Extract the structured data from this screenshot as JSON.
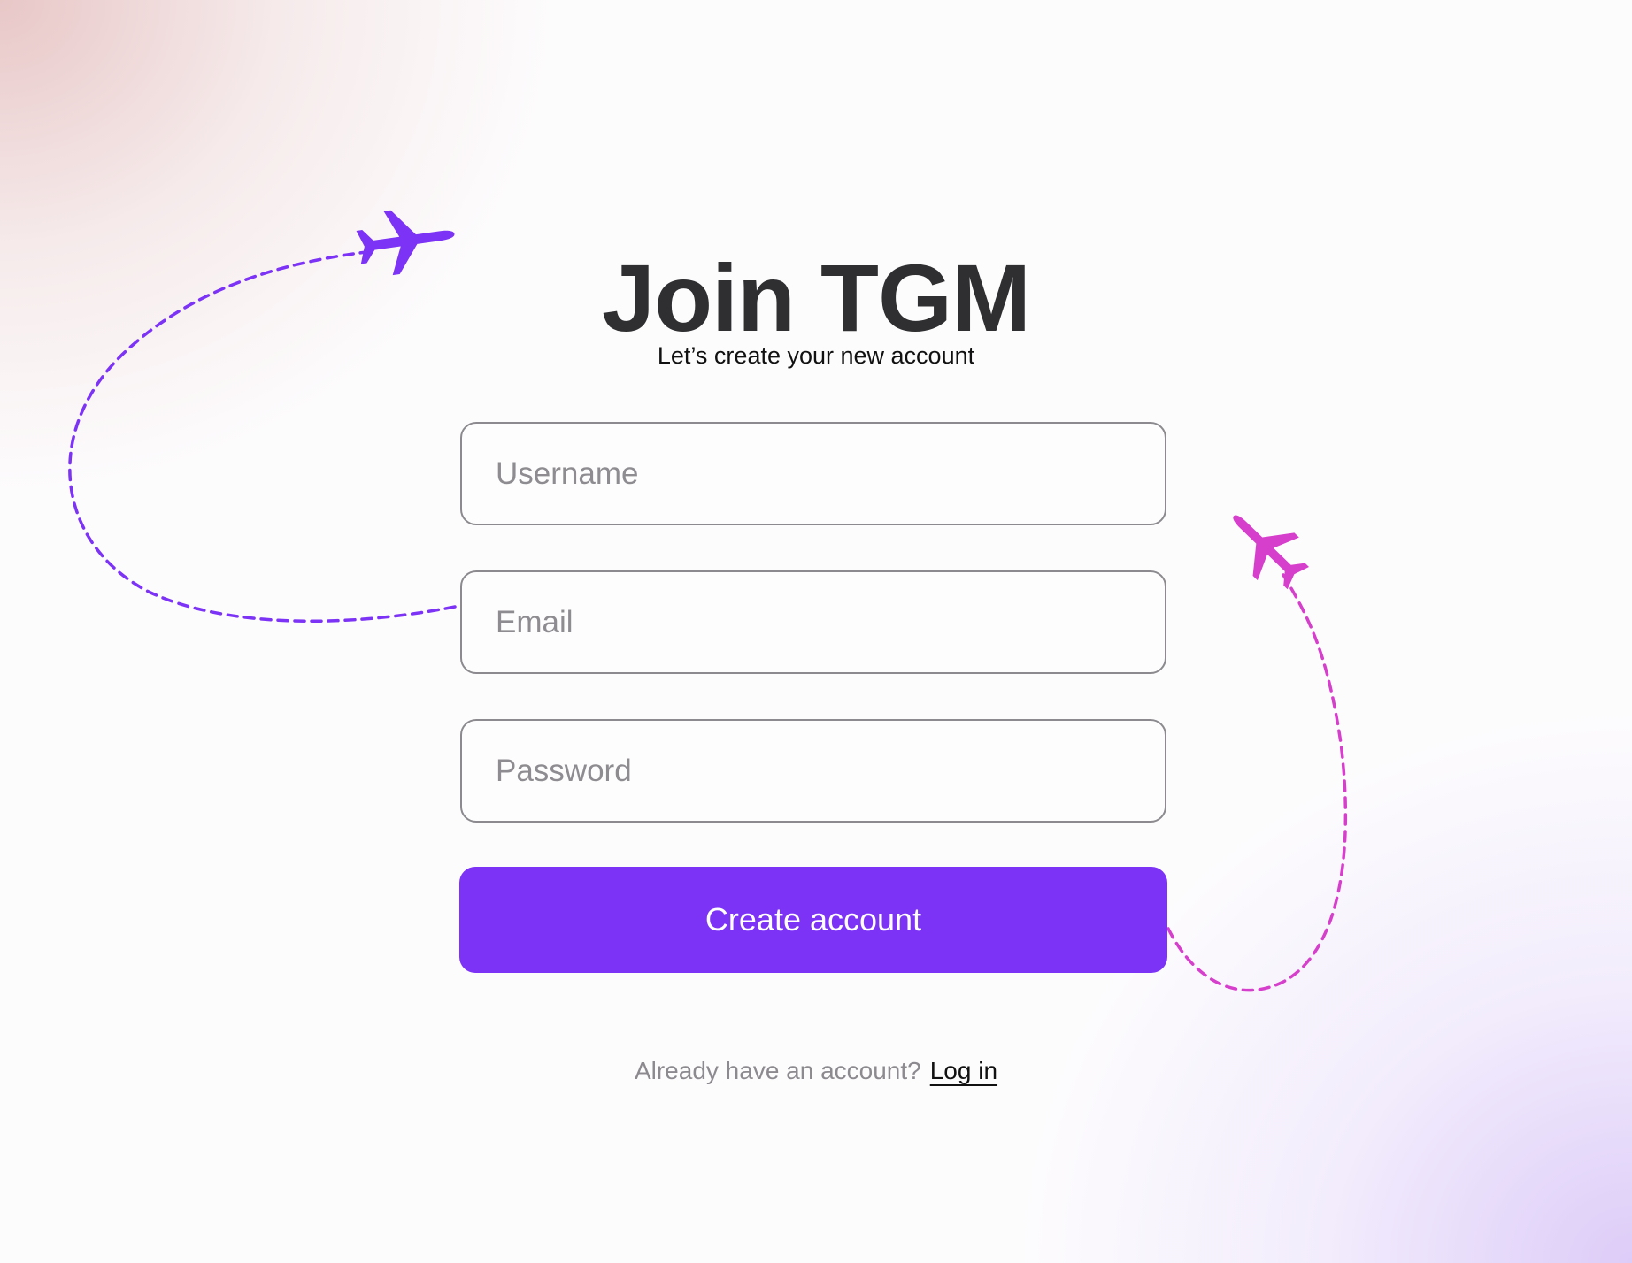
{
  "colors": {
    "accent": "#7c33f5",
    "title": "#2f2f31",
    "plane_left": "#7c33f5",
    "plane_right": "#d63fcb"
  },
  "header": {
    "title": "Join TGM",
    "subtitle": "Let’s create your new account"
  },
  "form": {
    "username_placeholder": "Username",
    "email_placeholder": "Email",
    "password_placeholder": "Password",
    "submit_label": "Create account"
  },
  "footer": {
    "prompt": "Already have an account?",
    "login_label": "Log in"
  },
  "decorations": {
    "left_icon": "airplane-icon",
    "right_icon": "airplane-icon"
  }
}
